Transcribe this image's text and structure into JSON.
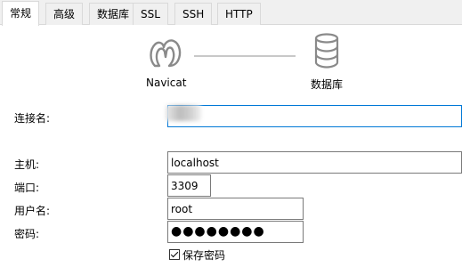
{
  "tabs": [
    "常规",
    "高级",
    "数据库",
    "SSL",
    "SSH",
    "HTTP"
  ],
  "diagram": {
    "client_label": "Navicat",
    "client_icon": "navicat-logo-icon",
    "server_label": "数据库",
    "server_icon": "database-icon"
  },
  "form": {
    "connection_name": {
      "label": "连接名:",
      "value": ""
    },
    "host": {
      "label": "主机:",
      "value": "localhost"
    },
    "port": {
      "label": "端口:",
      "value": "3309"
    },
    "username": {
      "label": "用户名:",
      "value": "root"
    },
    "password": {
      "label": "密码:",
      "masked_value": "●●●●●●●●"
    },
    "save_password": {
      "label": "保存密码",
      "checked": true
    }
  },
  "colors": {
    "focus_border": "#0078d7",
    "tab_bg": "#f0f0f0"
  }
}
